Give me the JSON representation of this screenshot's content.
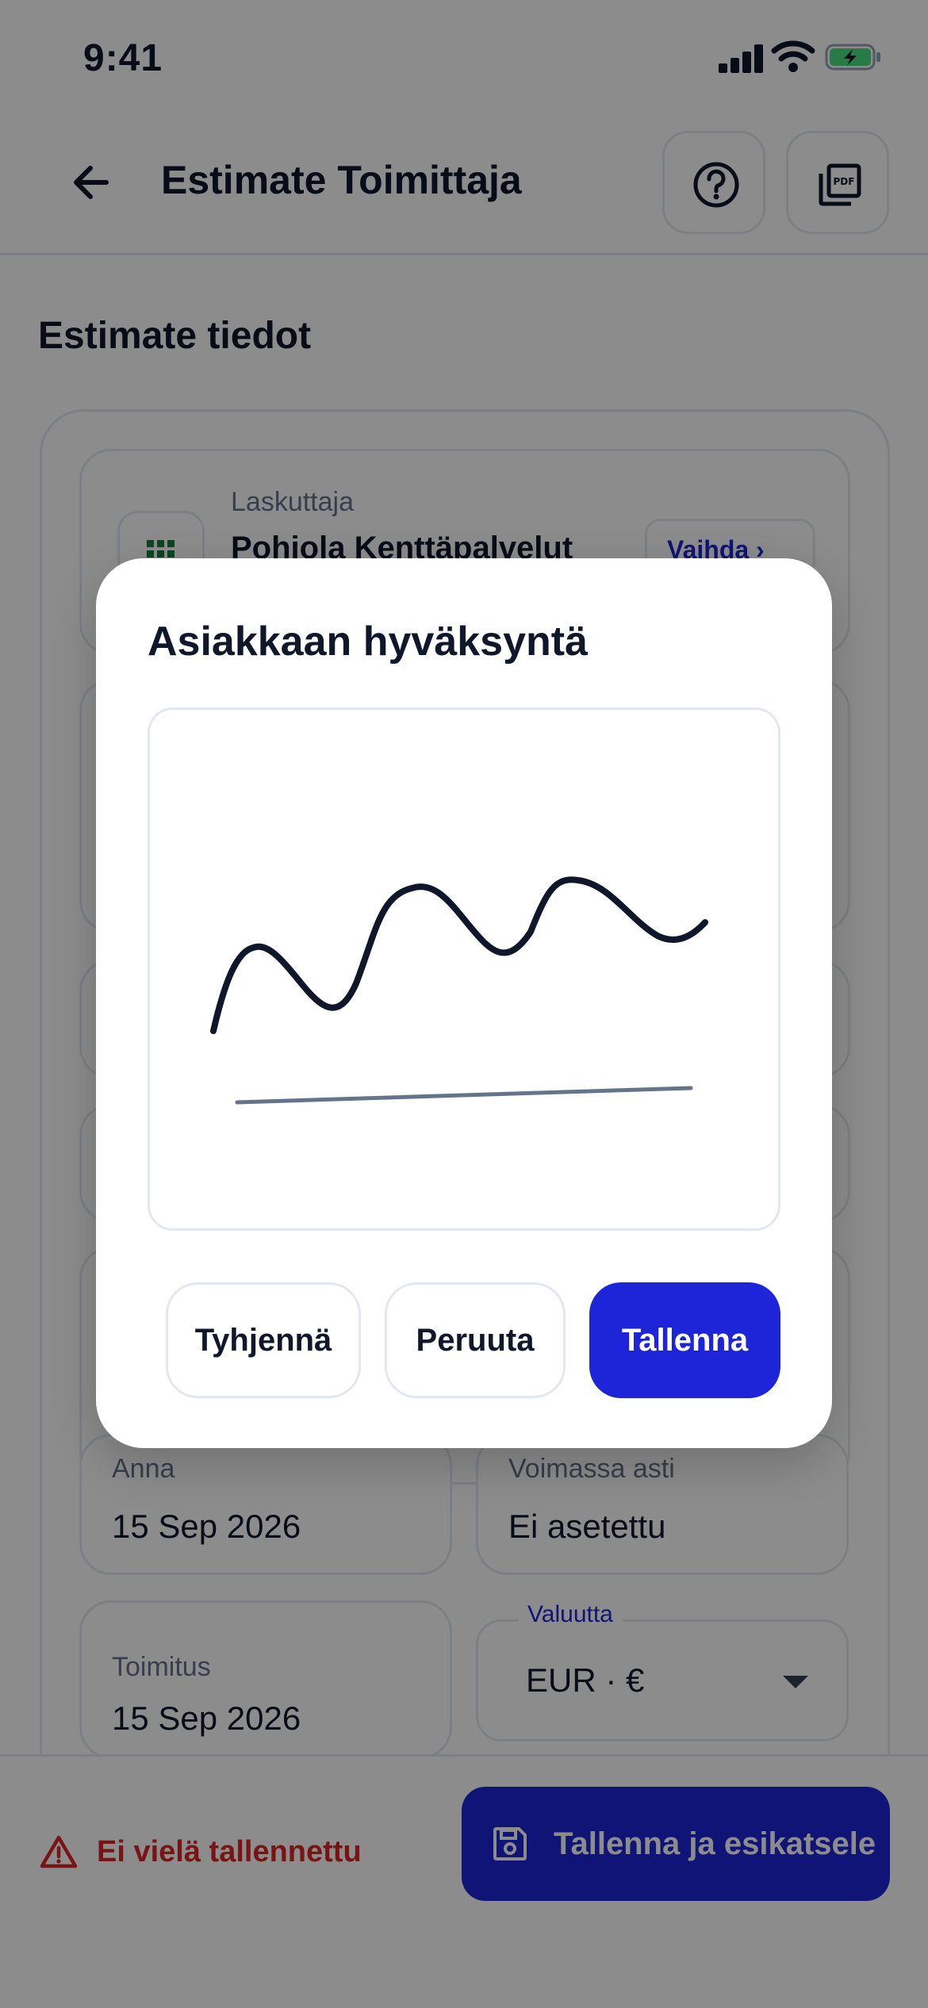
{
  "status_bar": {
    "time": "9:41"
  },
  "app_bar": {
    "title": "Estimate Toimittaja",
    "back_icon": "arrow-left-icon",
    "help_icon": "help-circle-icon",
    "pdf_icon": "pdf-icon"
  },
  "form": {
    "section_title": "Estimate tiedot",
    "biller": {
      "label": "Laskuttaja",
      "name": "Pohjola Kenttäpalvelut",
      "change_label": "Vaihda",
      "icon": "grid-icon"
    },
    "fields": [
      {
        "label": "Anna",
        "value": "15 Sep 2026"
      },
      {
        "label": "Voimassa asti",
        "value": "Ei asetettu"
      },
      {
        "label": "Toimitus",
        "value": "15 Sep 2026"
      }
    ],
    "currency": {
      "label": "Valuutta",
      "value": "EUR · €"
    }
  },
  "bottom_bar": {
    "unsaved_text": "Ei vielä tallennettu",
    "save_preview_label": "Tallenna ja esikatsele"
  },
  "dialog": {
    "title": "Asiakkaan hyväksyntä",
    "clear_label": "Tyhjennä",
    "cancel_label": "Peruuta",
    "save_label": "Tallenna"
  },
  "colors": {
    "accent": "#1e25d8",
    "warning": "#dc2626",
    "ink": "#0f172a",
    "border": "#e2e8f0"
  }
}
